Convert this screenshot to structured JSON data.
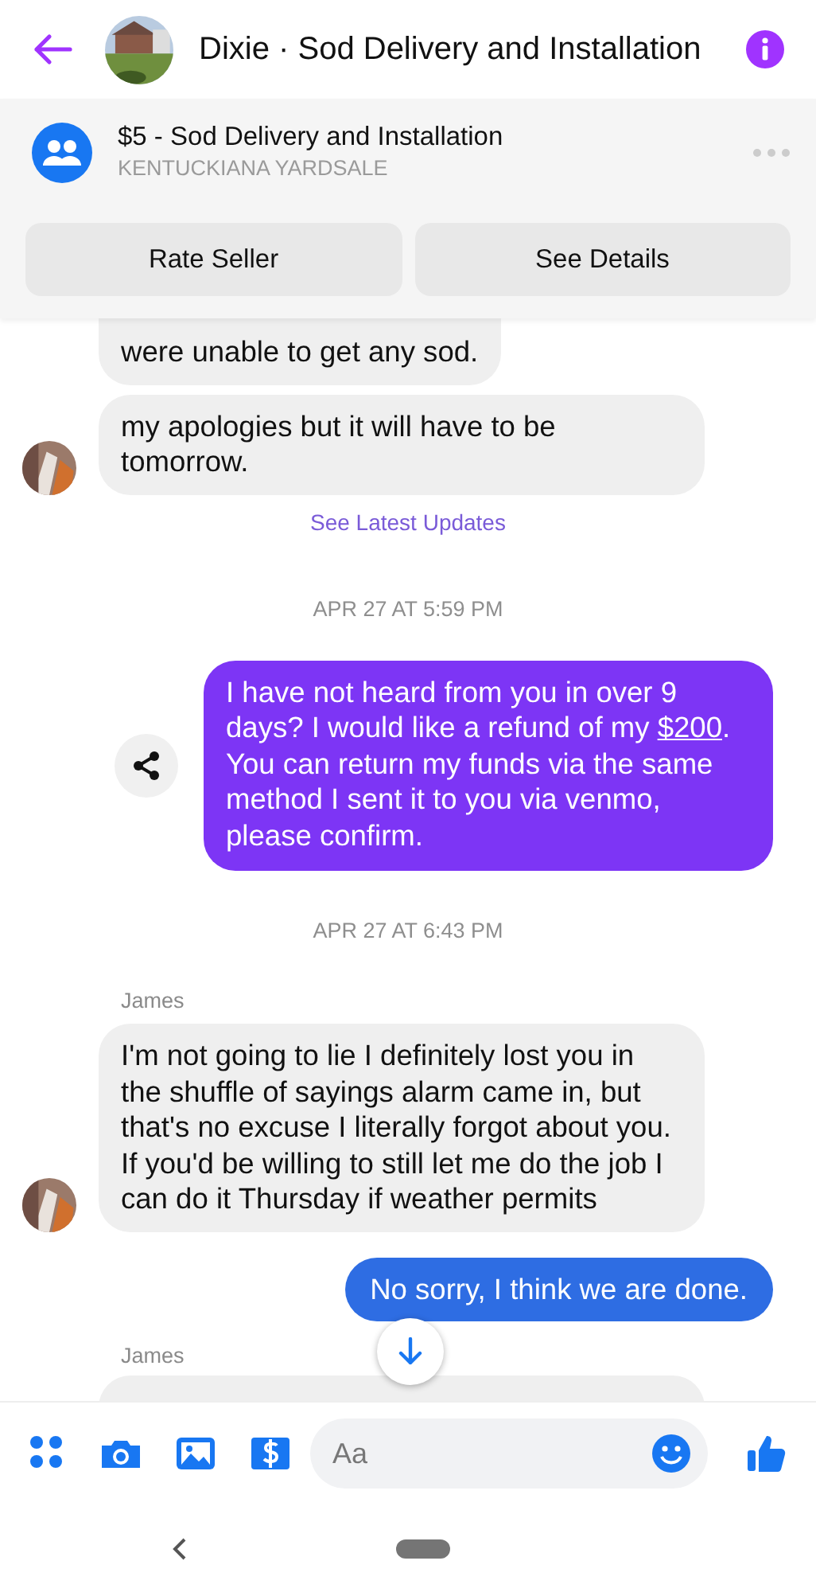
{
  "header": {
    "title": "Dixie · Sod Delivery and Installation"
  },
  "listing": {
    "title": "$5 - Sod Delivery and Installation",
    "group": "KENTUCKIANA YARDSALE",
    "buttons": [
      "Rate Seller",
      "See Details"
    ]
  },
  "messages": [
    {
      "kind": "incoming",
      "text": "were unable to get any sod.",
      "avatar": false,
      "cut": true
    },
    {
      "kind": "incoming",
      "text": "my apologies but it will have to be tomorrow.",
      "avatar": true
    },
    {
      "kind": "notice",
      "text": "See Latest Updates"
    },
    {
      "kind": "timestamp",
      "text": "APR 27 AT 5:59 PM"
    },
    {
      "kind": "outgoing",
      "color": "#7d35f5",
      "share": true,
      "parts": [
        {
          "text": "I have not heard from you in over 9 days? I would like a refund of my "
        },
        {
          "text": "$200",
          "link": true
        },
        {
          "text": ". You can return my funds via the same method I sent it to you via venmo, please confirm."
        }
      ]
    },
    {
      "kind": "timestamp",
      "text": "APR 27 AT 6:43 PM"
    },
    {
      "kind": "sender",
      "text": "James"
    },
    {
      "kind": "incoming",
      "text": "I'm not going to lie I definitely lost you in the shuffle of sayings alarm came in, but that's no excuse I literally forgot about you. If you'd be willing to still let me do the job I can do it Thursday if weather permits",
      "avatar": true
    },
    {
      "kind": "outgoing",
      "color": "#2e6de3",
      "share": false,
      "parts": [
        {
          "text": "No sorry, I think we are done."
        }
      ]
    },
    {
      "kind": "sender",
      "text": "James"
    },
    {
      "kind": "partial"
    }
  ],
  "composer": {
    "placeholder": "Aa"
  }
}
